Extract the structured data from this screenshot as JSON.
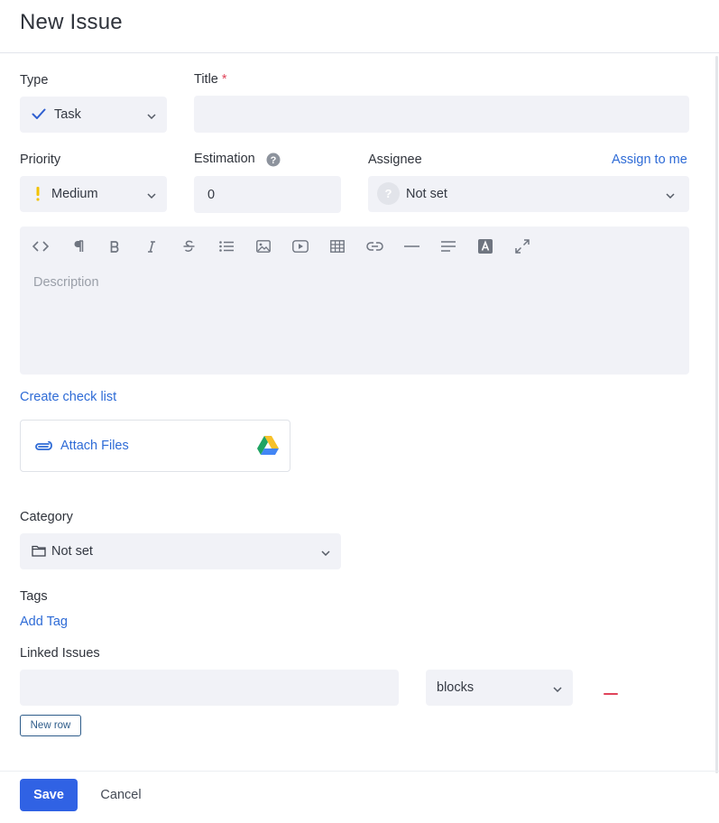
{
  "header": {
    "title": "New Issue"
  },
  "type": {
    "label": "Type",
    "value": "Task"
  },
  "title_field": {
    "label": "Title",
    "required_mark": "*",
    "value": ""
  },
  "priority": {
    "label": "Priority",
    "value": "Medium"
  },
  "estimation": {
    "label": "Estimation",
    "value": "0",
    "help_icon": "question-icon"
  },
  "assignee": {
    "label": "Assignee",
    "assign_to_me": "Assign to me",
    "value": "Not set",
    "avatar_glyph": "?"
  },
  "editor": {
    "placeholder": "Description",
    "toolbar": [
      "code",
      "paragraph",
      "bold",
      "italic",
      "strikethrough",
      "bullet-list",
      "image",
      "video",
      "table",
      "link",
      "horizontal-rule",
      "align",
      "text-color",
      "fullscreen"
    ]
  },
  "checklist": {
    "label": "Create check list"
  },
  "attach": {
    "label": "Attach Files"
  },
  "category": {
    "label": "Category",
    "value": "Not set"
  },
  "tags": {
    "label": "Tags",
    "add_label": "Add Tag"
  },
  "linked": {
    "label": "Linked Issues",
    "rows": [
      {
        "issue": "",
        "relation": "blocks"
      }
    ],
    "new_row_label": "New row"
  },
  "footer": {
    "save_label": "Save",
    "cancel_label": "Cancel"
  },
  "colors": {
    "accent": "#3062e4",
    "link": "#2e6bd6",
    "field_bg": "#f1f2f7",
    "required": "#e0445a",
    "priority_medium": "#f2c200"
  }
}
